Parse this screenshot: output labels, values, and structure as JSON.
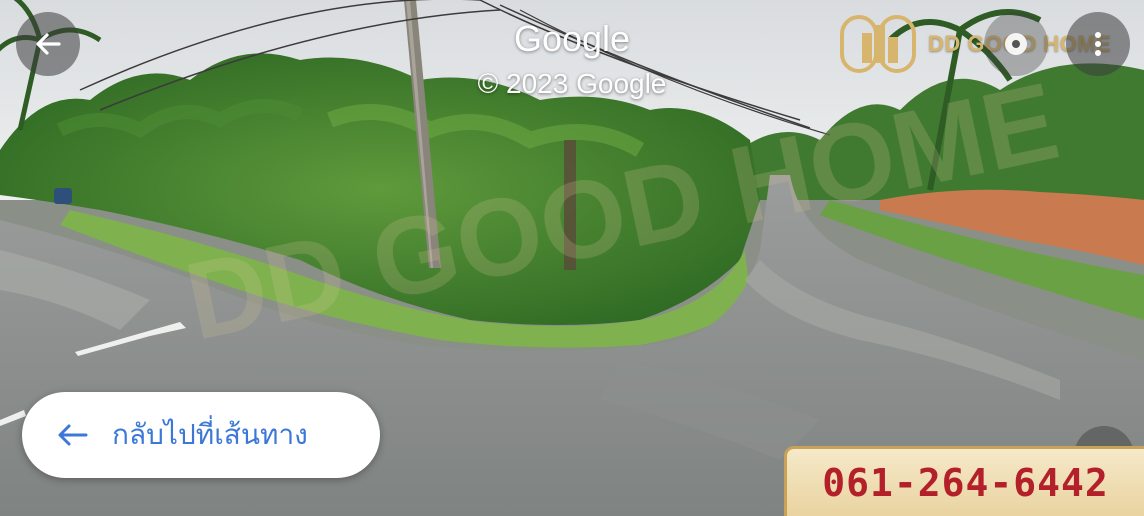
{
  "streetview": {
    "provider_logo": "Google",
    "copyright": "© 2023 Google",
    "back_icon": "arrow-left-icon",
    "menu_icon": "more-vertical-icon"
  },
  "brand": {
    "name": "DD GOOD HOME",
    "logo_letters": "DD",
    "accent_color": "#d7b56d"
  },
  "route_button": {
    "icon": "arrow-left-icon",
    "label": "กลับไปที่เส้นทาง",
    "color": "#3b78d8"
  },
  "contact": {
    "phone": "061-264-6442",
    "phone_color": "#b3202a"
  }
}
